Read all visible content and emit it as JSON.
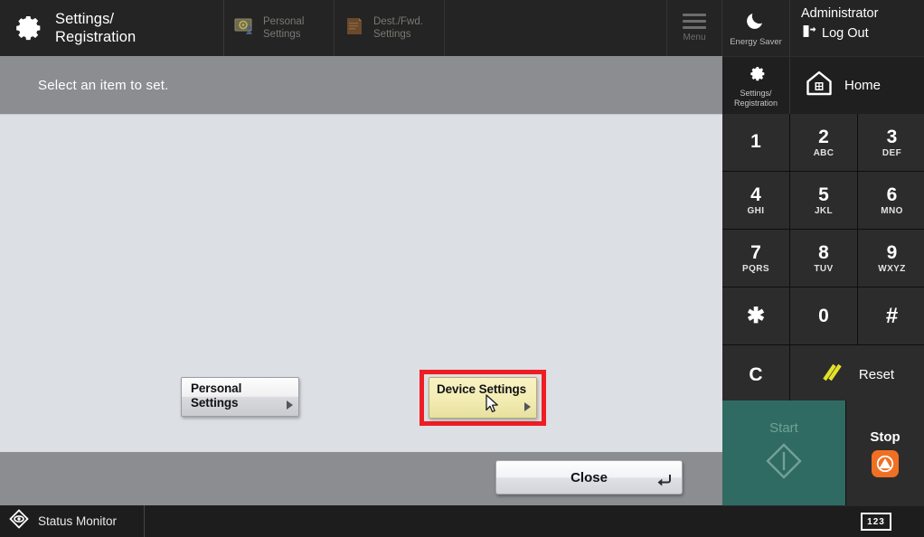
{
  "header": {
    "app_icon": "gear-icon",
    "title_line1": "Settings/",
    "title_line2": "Registration",
    "tabs": [
      {
        "icon": "personal-settings-icon",
        "line1": "Personal",
        "line2": "Settings"
      },
      {
        "icon": "dest-fwd-settings-icon",
        "line1": "Dest./Fwd.",
        "line2": "Settings"
      }
    ],
    "menu_label": "Menu"
  },
  "instruction": {
    "text": "Select an item to set."
  },
  "main": {
    "buttons": [
      {
        "line1": "Personal",
        "line2": "Settings",
        "style": "normal"
      },
      {
        "line1": "Device Settings",
        "line2": "",
        "style": "highlighted"
      }
    ],
    "cursor_icon": "mouse-pointer-icon",
    "highlight_color": "#ee1d23",
    "highlight_fill": "#f3ecb2"
  },
  "footer": {
    "close_label": "Close",
    "close_icon": "enter-arrow-icon"
  },
  "status": {
    "icon": "status-monitor-eye-icon",
    "label": "Status Monitor"
  },
  "hardkeys": {
    "energy_saver": {
      "icon": "moon-icon",
      "label": "Energy Saver"
    },
    "account": {
      "user": "Administrator",
      "logout_label": "Log Out",
      "logout_icon": "logout-door-icon"
    },
    "settings_registration": {
      "icon": "gear-icon",
      "line1": "Settings/",
      "line2": "Registration"
    },
    "home": {
      "icon": "home-icon",
      "label": "Home"
    },
    "keypad": [
      {
        "num": "1",
        "sub": ""
      },
      {
        "num": "2",
        "sub": "ABC"
      },
      {
        "num": "3",
        "sub": "DEF"
      },
      {
        "num": "4",
        "sub": "GHI"
      },
      {
        "num": "5",
        "sub": "JKL"
      },
      {
        "num": "6",
        "sub": "MNO"
      },
      {
        "num": "7",
        "sub": "PQRS"
      },
      {
        "num": "8",
        "sub": "TUV"
      },
      {
        "num": "9",
        "sub": "WXYZ"
      },
      {
        "num": "✱",
        "sub": ""
      },
      {
        "num": "0",
        "sub": ""
      },
      {
        "num": "#",
        "sub": ""
      }
    ],
    "clear_label": "C",
    "reset": {
      "label": "Reset",
      "icon": "reset-slashes-icon",
      "color": "#e4e12a"
    },
    "start": {
      "label": "Start",
      "icon": "start-diamond-icon",
      "color": "#2f6b62"
    },
    "stop": {
      "label": "Stop",
      "icon": "stop-icon",
      "color": "#ef7023"
    },
    "numeric_keys": {
      "label": "123",
      "icon": "numeric-keys-icon"
    }
  }
}
